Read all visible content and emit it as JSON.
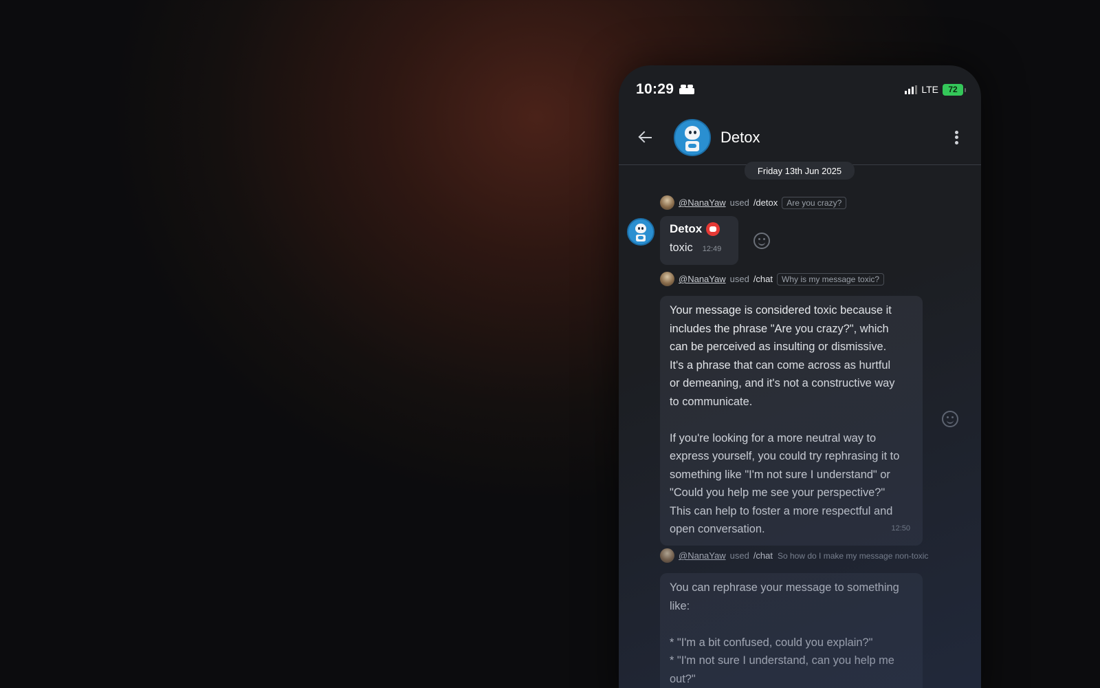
{
  "status_bar": {
    "time": "10:29",
    "network": "LTE",
    "battery": "72"
  },
  "header": {
    "title": "Detox"
  },
  "date_divider": "Friday 13th Jun 2025",
  "messages": [
    {
      "username": "@NanaYaw",
      "used": "used",
      "command": "/detox",
      "argument": "Are you crazy?",
      "sender": "Detox",
      "text": "toxic",
      "time": "12:49"
    },
    {
      "username": "@NanaYaw",
      "used": "used",
      "command": "/chat",
      "argument": "Why is my message toxic?",
      "text": "Your message is considered toxic because it\nincludes the phrase \"Are you crazy?\", which\ncan be perceived as insulting or dismissive.\nIt's a phrase that can come across as hurtful\nor demeaning, and it's not a constructive way\nto communicate.\n\nIf you're looking for a more neutral way to\nexpress yourself, you could try rephrasing it to\nsomething like \"I'm not sure I understand\" or\n\"Could you help me see your perspective?\"\nThis can help to foster a more respectful and\nopen conversation.",
      "time": "12:50"
    },
    {
      "username": "@NanaYaw",
      "used": "used",
      "command": "/chat",
      "argument": "So how do I make my message non-toxic",
      "text": "You can rephrase your message to something\nlike:\n\n* \"I'm a bit confused, could you explain?\"\n* \"I'm not sure I understand, can you help me\nout?\""
    }
  ],
  "colors": {
    "bot_badge": "#e53935",
    "battery": "#34c759",
    "bubble": "#2a2d34"
  }
}
